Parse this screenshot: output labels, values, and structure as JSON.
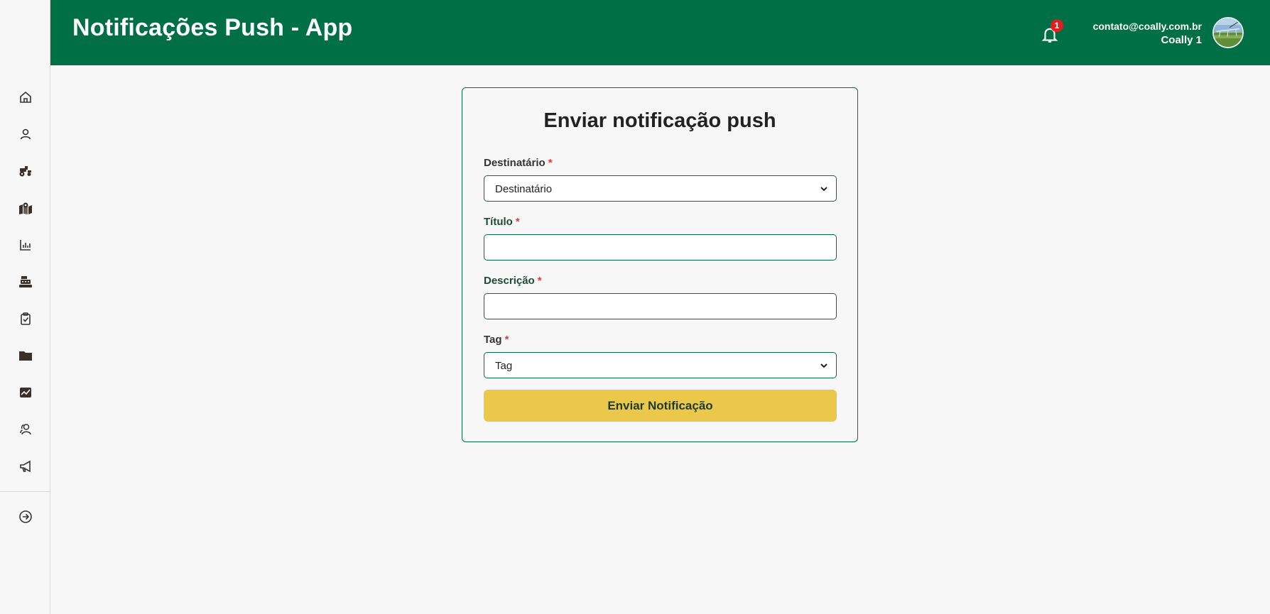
{
  "header": {
    "title": "Notificações Push - App",
    "notification_count": "1",
    "user_email": "contato@coally.com.br",
    "user_name": "Coally 1"
  },
  "sidebar": {
    "items": [
      {
        "icon": "home-icon"
      },
      {
        "icon": "user-icon"
      },
      {
        "icon": "tractor-icon"
      },
      {
        "icon": "map-location-icon"
      },
      {
        "icon": "bar-chart-icon"
      },
      {
        "icon": "cash-register-icon"
      },
      {
        "icon": "clipboard-check-icon"
      },
      {
        "icon": "folder-icon"
      },
      {
        "icon": "image-chart-icon"
      },
      {
        "icon": "users-icon"
      },
      {
        "icon": "megaphone-icon"
      }
    ],
    "footer_icon": "arrow-circle-right-icon"
  },
  "form": {
    "title": "Enviar notificação push",
    "required_mark": "*",
    "recipient_label": "Destinatário",
    "recipient_value": "Destinatário",
    "title_label": "Título",
    "title_value": "",
    "description_label": "Descrição",
    "description_value": "",
    "tag_label": "Tag",
    "tag_value": "Tag",
    "submit_label": "Enviar Notificação"
  },
  "colors": {
    "header_bg": "#016f45",
    "accent_button": "#ebc84a",
    "badge": "#e02020",
    "border": "#016f45"
  }
}
